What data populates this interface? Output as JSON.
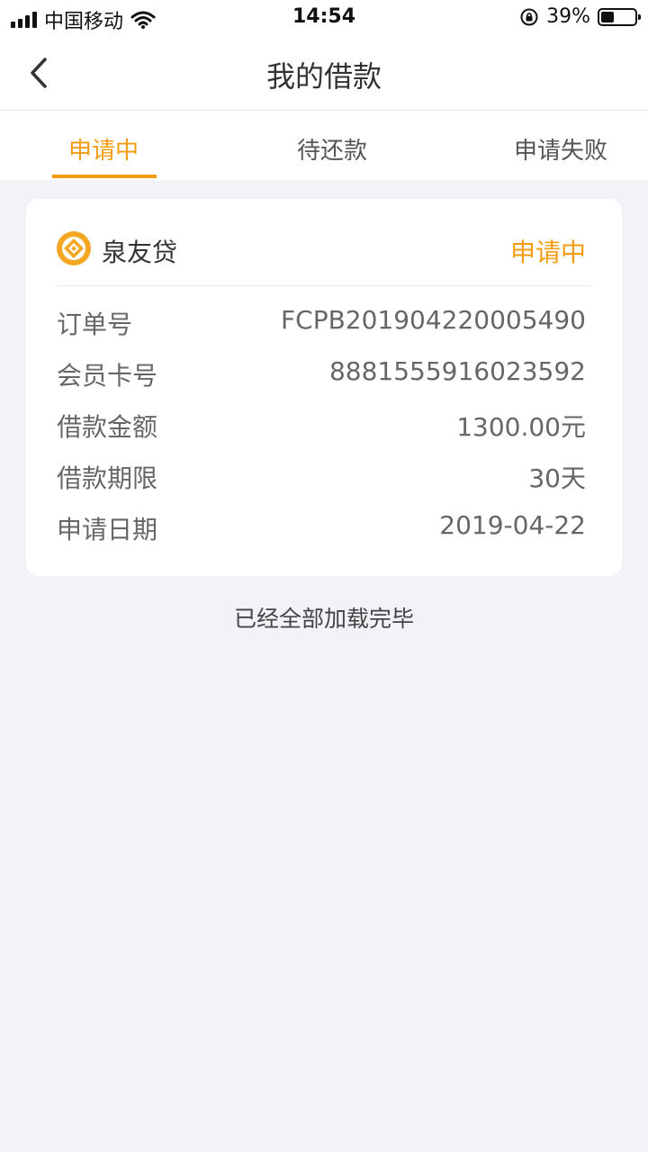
{
  "statusbar": {
    "carrier": "中国移动",
    "time": "14:54",
    "battery_percent_text": "39%",
    "battery_level": 0.39
  },
  "navbar": {
    "title": "我的借款"
  },
  "tabs": [
    {
      "label": "申请中",
      "active": true
    },
    {
      "label": "待还款",
      "active": false
    },
    {
      "label": "申请失败",
      "active": false
    }
  ],
  "loan_card": {
    "brand": "泉友贷",
    "status": "申请中",
    "rows": [
      {
        "label": "订单号",
        "value": "FCPB201904220005490"
      },
      {
        "label": "会员卡号",
        "value": "8881555916023592"
      },
      {
        "label": "借款金额",
        "value": "1300.00元"
      },
      {
        "label": "借款期限",
        "value": "30天"
      },
      {
        "label": "申请日期",
        "value": "2019-04-22"
      }
    ]
  },
  "footer_note": "已经全部加载完毕",
  "colors": {
    "accent": "#f39c12",
    "background": "#f2f3f7",
    "text_secondary": "#666666"
  },
  "icons": {
    "back": "chevron-left-icon",
    "brand_logo": "quanyoudai-logo-icon",
    "wifi": "wifi-icon",
    "battery": "battery-icon",
    "signal": "signal-bars-icon",
    "orientation_lock": "orientation-lock-icon"
  }
}
